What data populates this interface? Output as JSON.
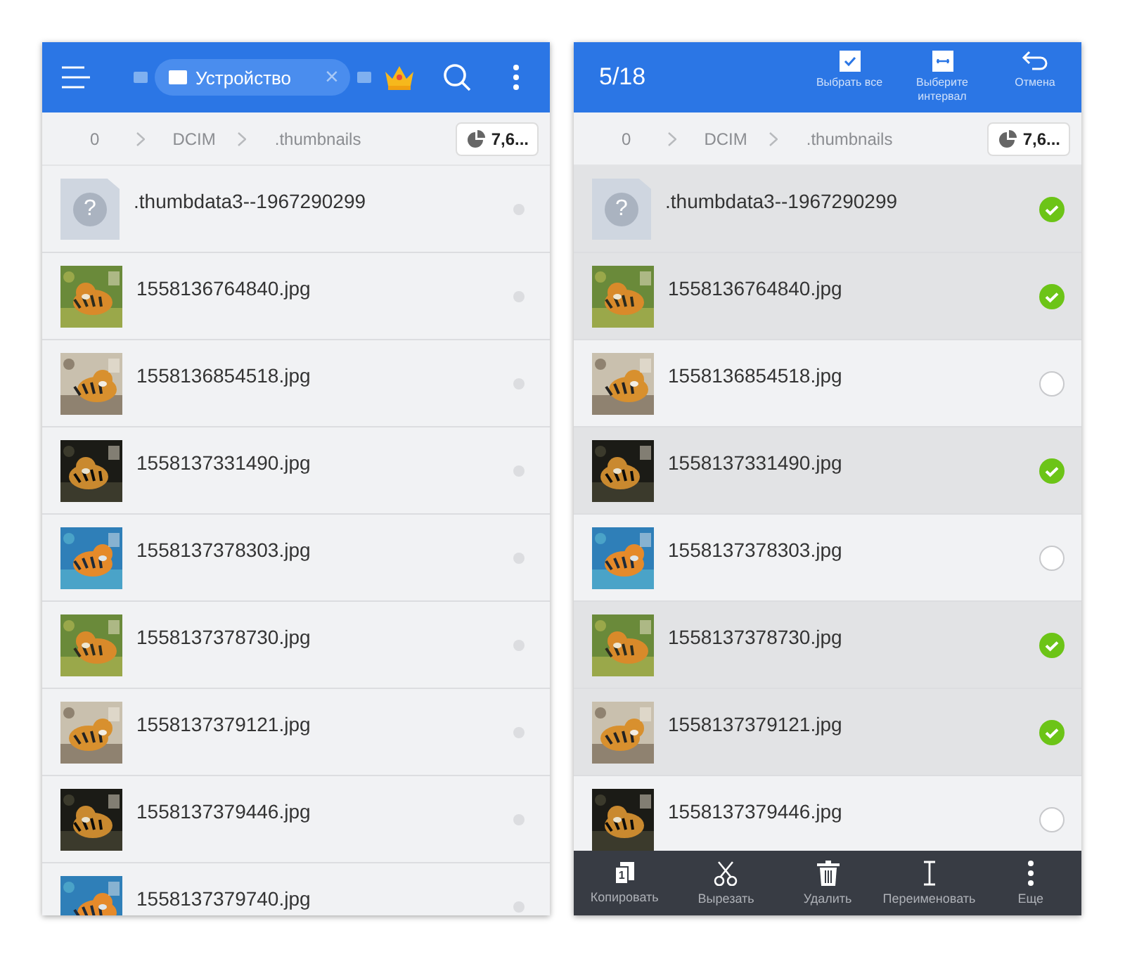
{
  "panels": [
    {
      "kind": "browse",
      "tab": {
        "label": "Устройство",
        "close": "×"
      },
      "breadcrumb": [
        "0",
        "DCIM",
        ".thumbnails"
      ],
      "storage": "7,6...",
      "files": [
        {
          "name": ".thumbdata3--1967290299",
          "kind": "unknown",
          "glyph": "?"
        },
        {
          "name": "1558136764840.jpg",
          "kind": "picture"
        },
        {
          "name": "1558136854518.jpg",
          "kind": "picture"
        },
        {
          "name": "1558137331490.jpg",
          "kind": "picture"
        },
        {
          "name": "1558137378303.jpg",
          "kind": "picture"
        },
        {
          "name": "1558137378730.jpg",
          "kind": "picture"
        },
        {
          "name": "1558137379121.jpg",
          "kind": "picture"
        },
        {
          "name": "1558137379446.jpg",
          "kind": "picture"
        },
        {
          "name": "1558137379740.jpg",
          "kind": "picture"
        }
      ]
    },
    {
      "kind": "select",
      "count": "5/18",
      "actions": [
        {
          "kind": "select-all",
          "label": "Выбрать все"
        },
        {
          "kind": "range",
          "label": "Выберите интервал"
        },
        {
          "kind": "cancel",
          "label": "Отмена"
        }
      ],
      "breadcrumb": [
        "0",
        "DCIM",
        ".thumbnails"
      ],
      "storage": "7,6...",
      "files": [
        {
          "name": ".thumbdata3--1967290299",
          "kind": "unknown",
          "glyph": "?",
          "selected": true
        },
        {
          "name": "1558136764840.jpg",
          "kind": "picture",
          "selected": true
        },
        {
          "name": "1558136854518.jpg",
          "kind": "picture",
          "selected": false
        },
        {
          "name": "1558137331490.jpg",
          "kind": "picture",
          "selected": true
        },
        {
          "name": "1558137378303.jpg",
          "kind": "picture",
          "selected": false
        },
        {
          "name": "1558137378730.jpg",
          "kind": "picture",
          "selected": true
        },
        {
          "name": "1558137379121.jpg",
          "kind": "picture",
          "selected": true
        },
        {
          "name": "1558137379446.jpg",
          "kind": "picture",
          "selected": false
        }
      ],
      "toolbar": [
        {
          "kind": "copy",
          "label": "Копировать",
          "badge": "1"
        },
        {
          "kind": "cut",
          "label": "Вырезать"
        },
        {
          "kind": "delete",
          "label": "Удалить"
        },
        {
          "kind": "rename",
          "label": "Переименовать"
        },
        {
          "kind": "more",
          "label": "Еще"
        }
      ]
    }
  ]
}
